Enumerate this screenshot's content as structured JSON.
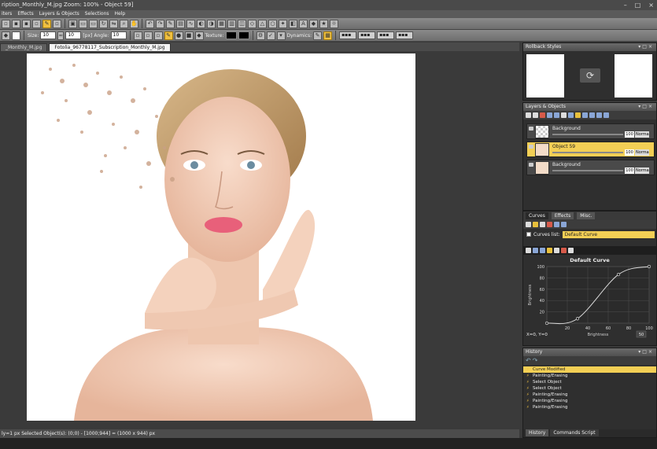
{
  "title": "ription_Monthly_M.jpg Zoom: 100% - Object 59]",
  "window_controls": [
    "–",
    "□",
    "×"
  ],
  "menu": [
    "iters",
    "Effects",
    "Layers & Objects",
    "Selections",
    "Help"
  ],
  "toolbar2": {
    "size_label": "Size:",
    "size_w": "10",
    "size_h": "10",
    "unit": "[px]",
    "angle_label": "Angle:",
    "angle_value": "10",
    "texture_label": "Texture:",
    "dynamics_label": "Dynamics:"
  },
  "tabs": [
    "_Monthly_M.jpg",
    "Fotolia_96778117_Subscription_Monthly_M.jpg"
  ],
  "status": "ly=1 px  Selected Object(s): (0;0) - [1000;944] = (1000 x 944) px",
  "panels": {
    "rollback": {
      "title": "Rollback Styles"
    },
    "layers": {
      "title": "Layers & Objects",
      "items": [
        {
          "name": "Background",
          "opacity": "100",
          "mode": "Norma"
        },
        {
          "name": "Object 59",
          "opacity": "100",
          "mode": "Norma"
        },
        {
          "name": "Background",
          "opacity": "100",
          "mode": "Norma"
        }
      ]
    },
    "curves": {
      "tabs": [
        "Curves",
        "Effects",
        "Misc."
      ],
      "list_label": "Curves list:",
      "list_value": "Default Curve",
      "chart_title": "Default Curve",
      "coords": "X=0, Y=0",
      "xlabel": "Brightness",
      "ylabel": "Brightness",
      "field": "50"
    },
    "history": {
      "title": "History",
      "items": [
        "Curve Modified",
        "Painting/Erasing",
        "Select Object",
        "Select Object",
        "Painting/Erasing",
        "Painting/Erasing",
        "Painting/Erasing"
      ],
      "tabs": [
        "History",
        "Commands Script"
      ]
    }
  },
  "chart_data": {
    "type": "line",
    "title": "Default Curve",
    "xlabel": "Brightness",
    "ylabel": "Brightness",
    "x_ticks": [
      "20",
      "40",
      "60",
      "80",
      "100"
    ],
    "y_ticks": [
      "100",
      "80",
      "60",
      "40",
      "20"
    ],
    "xlim": [
      0,
      100
    ],
    "ylim": [
      0,
      100
    ],
    "x": [
      0,
      30,
      70,
      100
    ],
    "y": [
      0,
      8,
      86,
      100
    ]
  },
  "colors": {
    "accent": "#f3cf55",
    "panel_bg": "#2f2f2f",
    "canvas_bg": "#ffffff"
  }
}
